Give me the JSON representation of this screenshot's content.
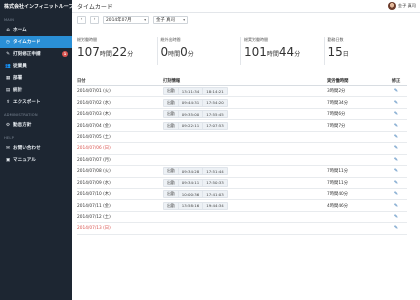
{
  "brand": "株式会社インフィニットループ",
  "sidebar": {
    "sections": [
      {
        "label": "MAIN",
        "items": [
          {
            "label": "ホーム",
            "icon": "home-icon",
            "glyph": "⌂"
          },
          {
            "label": "タイムカード",
            "icon": "clock-icon",
            "glyph": "◷",
            "active": true
          },
          {
            "label": "打刻修正申請",
            "icon": "edit-request-icon",
            "glyph": "✎",
            "badge": "1"
          },
          {
            "label": "従業員",
            "icon": "users-icon",
            "glyph": "👥"
          },
          {
            "label": "部署",
            "icon": "department-icon",
            "glyph": "▦"
          },
          {
            "label": "統計",
            "icon": "statistics-icon",
            "glyph": "▤"
          },
          {
            "label": "エクスポート",
            "icon": "export-icon",
            "glyph": "⇪"
          }
        ]
      },
      {
        "label": "ADMINISTRATION",
        "items": [
          {
            "label": "勤怠方針",
            "icon": "policy-icon",
            "glyph": "⚙"
          }
        ]
      },
      {
        "label": "HELP",
        "items": [
          {
            "label": "お問い合わせ",
            "icon": "mail-icon",
            "glyph": "✉"
          },
          {
            "label": "マニュアル",
            "icon": "book-icon",
            "glyph": "▣"
          }
        ]
      }
    ]
  },
  "header": {
    "title": "タイムカード",
    "user_name": "金子 真司"
  },
  "toolbar": {
    "prev_label": "‹",
    "next_label": "›",
    "month": "2014年07月",
    "employee": "金子 真司",
    "caret": "▾"
  },
  "stats": [
    {
      "label": "総労働時間",
      "value1": "107",
      "unit1": "時間",
      "value2": "22",
      "unit2": "分"
    },
    {
      "label": "総外出時間",
      "value1": "0",
      "unit1": "時間",
      "value2": "0",
      "unit2": "分"
    },
    {
      "label": "総実労働時間",
      "value1": "101",
      "unit1": "時間",
      "value2": "44",
      "unit2": "分"
    },
    {
      "label": "勤務日数",
      "value1": "15",
      "unit1": "日",
      "value2": "",
      "unit2": ""
    }
  ],
  "table": {
    "headers": [
      "日付",
      "打刻情報",
      "実労働時間",
      "修正"
    ],
    "edit_glyph": "✎",
    "rows": [
      {
        "date": "2014/07/01 (火)",
        "type": "出勤",
        "in": "13:11:34",
        "out": "18:14:21",
        "work": "3時間2分"
      },
      {
        "date": "2014/07/02 (水)",
        "type": "出勤",
        "in": "09:44:31",
        "out": "17:54:20",
        "work": "7時間34分"
      },
      {
        "date": "2014/07/03 (木)",
        "type": "出勤",
        "in": "09:35:00",
        "out": "17:55:45",
        "work": "7時間6分"
      },
      {
        "date": "2014/07/04 (金)",
        "type": "出勤",
        "in": "09:22:11",
        "out": "17:07:53",
        "work": "7時間7分"
      },
      {
        "date": "2014/07/05 (土)",
        "type": "",
        "in": "",
        "out": "",
        "work": ""
      },
      {
        "date": "2014/07/06 (日)",
        "type": "",
        "in": "",
        "out": "",
        "work": "",
        "sunday": true
      },
      {
        "date": "2014/07/07 (月)",
        "type": "",
        "in": "",
        "out": "",
        "work": ""
      },
      {
        "date": "2014/07/08 (火)",
        "type": "出勤",
        "in": "09:34:28",
        "out": "17:51:44",
        "work": "7時間11分"
      },
      {
        "date": "2014/07/09 (水)",
        "type": "出勤",
        "in": "09:34:11",
        "out": "17:50:33",
        "work": "7時間11分"
      },
      {
        "date": "2014/07/10 (木)",
        "type": "出勤",
        "in": "10:00:36",
        "out": "17:41:03",
        "work": "7時間40分"
      },
      {
        "date": "2014/07/11 (金)",
        "type": "出勤",
        "in": "13:58:16",
        "out": "19:44:34",
        "work": "4時間46分"
      },
      {
        "date": "2014/07/12 (土)",
        "type": "",
        "in": "",
        "out": "",
        "work": ""
      },
      {
        "date": "2014/07/13 (日)",
        "type": "",
        "in": "",
        "out": "",
        "work": "",
        "sunday": true
      }
    ]
  }
}
